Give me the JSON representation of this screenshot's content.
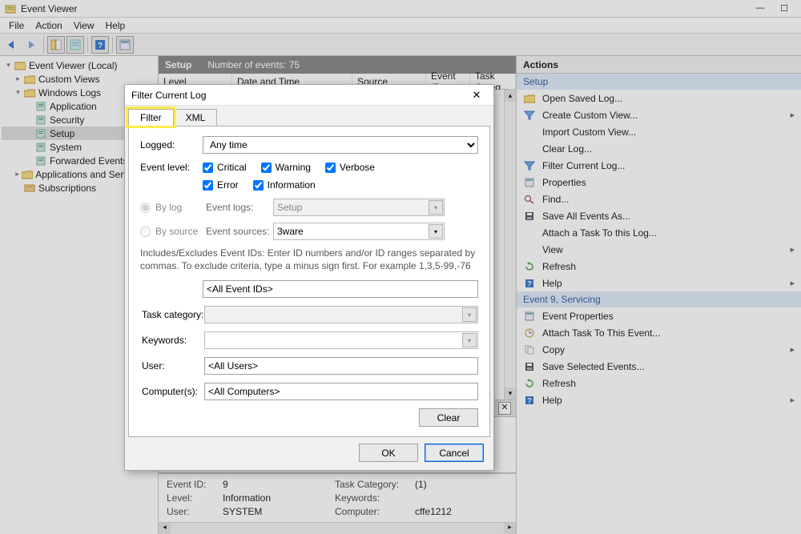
{
  "window": {
    "title": "Event Viewer"
  },
  "menu": [
    "File",
    "Action",
    "View",
    "Help"
  ],
  "tree": {
    "root": "Event Viewer (Local)",
    "custom_views": "Custom Views",
    "windows_logs": "Windows Logs",
    "wl": {
      "app": "Application",
      "sec": "Security",
      "setup": "Setup",
      "sys": "System",
      "fwd": "Forwarded Events"
    },
    "apps_services": "Applications and Services ...",
    "subs": "Subscriptions"
  },
  "center": {
    "title": "Setup",
    "count_label": "Number of events: 75",
    "cols": {
      "level": "Level",
      "dt": "Date and Time",
      "source": "Source",
      "eid": "Event ID",
      "tc": "Task Categ..."
    }
  },
  "detail": {
    "eid_lbl": "Event ID:",
    "eid_val": "9",
    "tc_lbl": "Task Category:",
    "tc_val": "(1)",
    "lvl_lbl": "Level:",
    "lvl_val": "Information",
    "kw_lbl": "Keywords:",
    "kw_val": "",
    "user_lbl": "User:",
    "user_val": "SYSTEM",
    "comp_lbl": "Computer:",
    "comp_val": "cffe1212"
  },
  "actions": {
    "header": "Actions",
    "grp1": "Setup",
    "a1": "Open Saved Log...",
    "a2": "Create Custom View...",
    "a3": "Import Custom View...",
    "a4": "Clear Log...",
    "a5": "Filter Current Log...",
    "a6": "Properties",
    "a7": "Find...",
    "a8": "Save All Events As...",
    "a9": "Attach a Task To this Log...",
    "a10": "View",
    "a11": "Refresh",
    "a12": "Help",
    "grp2": "Event 9, Servicing",
    "b1": "Event Properties",
    "b2": "Attach Task To This Event...",
    "b3": "Copy",
    "b4": "Save Selected Events...",
    "b5": "Refresh",
    "b6": "Help"
  },
  "dialog": {
    "title": "Filter Current Log",
    "tabs": {
      "filter": "Filter",
      "xml": "XML"
    },
    "logged": {
      "lbl": "Logged:",
      "val": "Any time"
    },
    "level": {
      "lbl": "Event level:",
      "critical": "Critical",
      "warning": "Warning",
      "verbose": "Verbose",
      "error": "Error",
      "information": "Information"
    },
    "bylog": "By log",
    "bysource": "By source",
    "eventlogs": {
      "lbl": "Event logs:",
      "val": "Setup"
    },
    "eventsources": {
      "lbl": "Event sources:",
      "val": "3ware"
    },
    "note": "Includes/Excludes Event IDs: Enter ID numbers and/or ID ranges separated by commas. To exclude criteria, type a minus sign first. For example 1,3,5-99,-76",
    "eventids": "<All Event IDs>",
    "taskcat": "Task category:",
    "keywords": "Keywords:",
    "user": {
      "lbl": "User:",
      "val": "<All Users>"
    },
    "computers": {
      "lbl": "Computer(s):",
      "val": "<All Computers>"
    },
    "clear": "Clear",
    "ok": "OK",
    "cancel": "Cancel"
  }
}
